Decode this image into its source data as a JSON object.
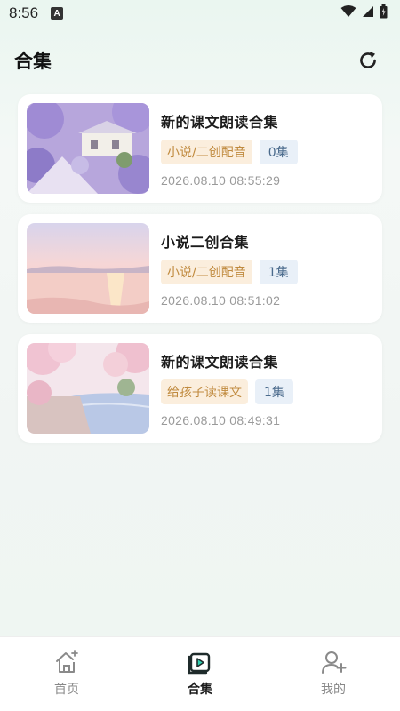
{
  "status_bar": {
    "time": "8:56",
    "badge": "A"
  },
  "header": {
    "title": "合集"
  },
  "collections": [
    {
      "title": "新的课文朗读合集",
      "category": "小说/二创配音",
      "count": "0集",
      "date": "2026.08.10 08:55:29",
      "thumb": "purple-cottage"
    },
    {
      "title": "小说二创合集",
      "category": "小说/二创配音",
      "count": "1集",
      "date": "2026.08.10 08:51:02",
      "thumb": "pink-sunset-sea"
    },
    {
      "title": "新的课文朗读合集",
      "category": "给孩子读课文",
      "count": "1集",
      "date": "2026.08.10 08:49:31",
      "thumb": "cherry-blossom-river"
    }
  ],
  "bottom_nav": {
    "items": [
      {
        "label": "首页",
        "icon": "home-icon",
        "active": false
      },
      {
        "label": "合集",
        "icon": "collection-play-icon",
        "active": true
      },
      {
        "label": "我的",
        "icon": "user-add-icon",
        "active": false
      }
    ]
  },
  "colors": {
    "accent_tag_bg": "#fbeedd",
    "accent_tag_text": "#c08a3e",
    "count_tag_bg": "#e9f0f8",
    "count_tag_text": "#4a6a8c"
  }
}
